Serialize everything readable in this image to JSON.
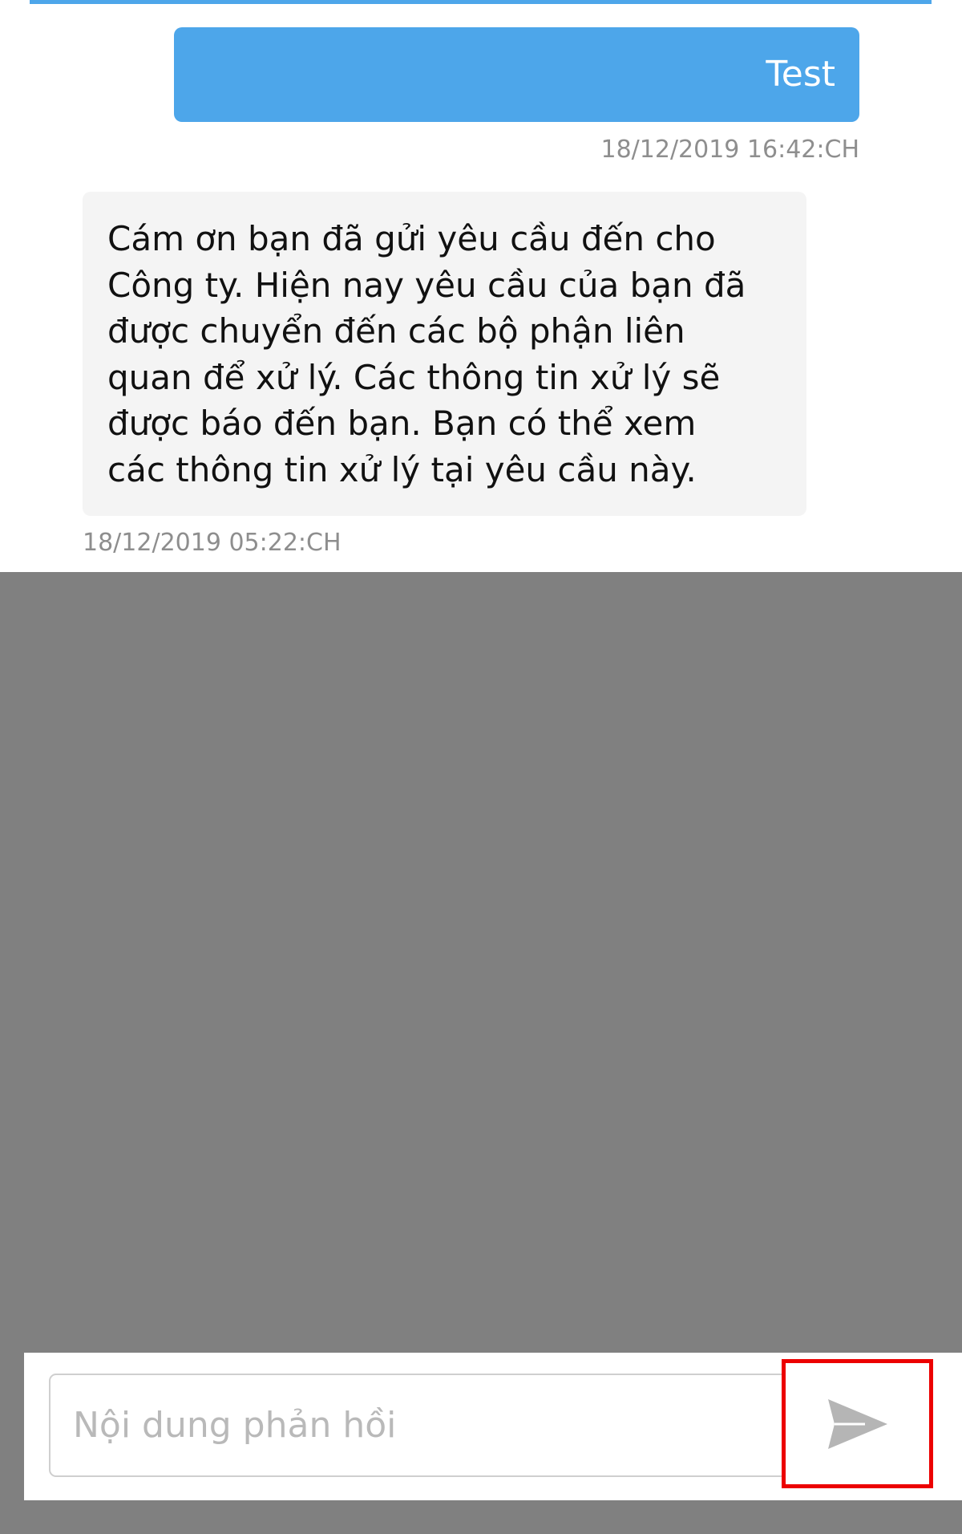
{
  "messages": {
    "sent": {
      "text": "Test",
      "timestamp": "18/12/2019 16:42:CH"
    },
    "received": {
      "text": "Cám ơn bạn đã gửi yêu cầu đến cho\nCông ty. Hiện nay yêu cầu của bạn đã\nđược chuyển đến các bộ phận liên\nquan để xử lý. Các thông tin xử lý sẽ\nđược báo đến bạn. Bạn có thể xem\ncác thông tin xử lý tại yêu cầu này.",
      "timestamp": "18/12/2019 05:22:CH"
    }
  },
  "reply": {
    "placeholder": "Nội dung phản hồi",
    "value": ""
  },
  "send_button": {
    "icon": "send-icon",
    "highlight_color": "#ec0000"
  },
  "colors": {
    "accent": "#4da6ea",
    "overlay": "#808080",
    "received_bubble": "#f4f4f4",
    "timestamp": "#8e8e8e"
  }
}
